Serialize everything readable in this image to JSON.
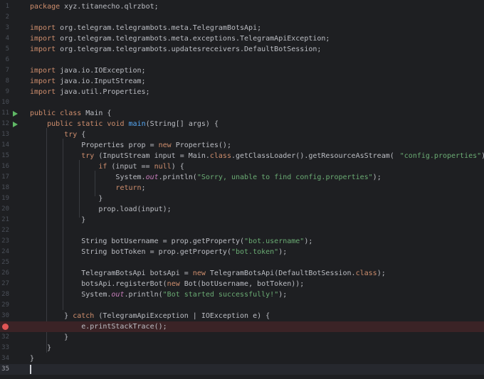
{
  "editor": {
    "gutter_numbers": [
      "1",
      "2",
      "3",
      "4",
      "5",
      "6",
      "7",
      "8",
      "9",
      "10",
      "11",
      "12",
      "13",
      "14",
      "15",
      "16",
      "17",
      "18",
      "19",
      "20",
      "21",
      "22",
      "23",
      "24",
      "25",
      "26",
      "27",
      "28",
      "29",
      "30",
      "31",
      "32",
      "33",
      "34",
      "35"
    ],
    "hint_label": "name:",
    "tokens": {
      "package": "package",
      "package_name": " xyz.titanecho.qlrzbot;",
      "import": "import",
      "imp3": " org.telegram.telegrambots.meta.TelegramBotsApi;",
      "imp4": " org.telegram.telegrambots.meta.exceptions.TelegramApiException;",
      "imp5": " org.telegram.telegrambots.updatesreceivers.DefaultBotSession;",
      "imp7": " java.io.IOException;",
      "imp8": " java.io.InputStream;",
      "imp9": " java.util.Properties;",
      "public": "public",
      "class": "class",
      "static": "static",
      "void": "void",
      "try": "try",
      "new": "new",
      "if": "if",
      "null": "null",
      "return": "return",
      "catch": "catch",
      "class_name": " Main {",
      "main": "main",
      "main_args": "(String[] args) {",
      "try_open": " {",
      "props_decl": "Properties prop = ",
      "props_new": " Properties();",
      "try_res_a": " (InputStream input = Main.",
      "try_res_b": ".getClassLoader().getResourceAsStream(",
      "config_str": "\"config.properties\"",
      "try_res_c": ")) {",
      "if_a": " (input == ",
      "if_b": ") {",
      "sys": "System.",
      "out": "out",
      "println": ".println(",
      "sorry_str": "\"Sorry, unable to find config.properties\"",
      "close_paren_semi": ");",
      "semi": ";",
      "close_brace": "}",
      "load": "prop.load(input);",
      "user_decl": "String botUsername = prop.getProperty(",
      "user_str": "\"bot.username\"",
      "token_decl": "String botToken = prop.getProperty(",
      "token_str": "\"bot.token\"",
      "api_decl": "TelegramBotsApi botsApi = ",
      "api_new": " TelegramBotsApi(DefaultBotSession.",
      "api_end": ");",
      "register_a": "botsApi.registerBot(",
      "register_b": " Bot(botUsername, botToken));",
      "started_str": "\"Bot started successfully!\"",
      "catch_close": "} ",
      "catch_args": " (TelegramApiException | IOException e) {",
      "print_trace": "e.printStackTrace();"
    }
  }
}
